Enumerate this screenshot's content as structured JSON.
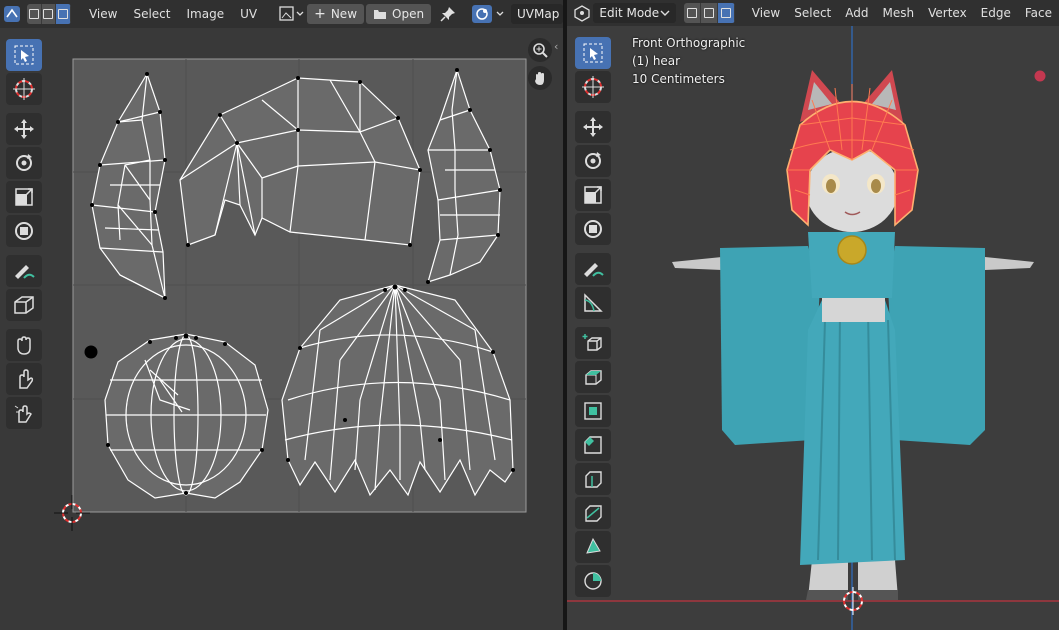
{
  "uv_editor": {
    "menus": [
      "View",
      "Select",
      "Image",
      "UV"
    ],
    "new_label": "New",
    "open_label": "Open",
    "uvmap_label": "UVMap"
  },
  "viewport": {
    "mode_label": "Edit Mode",
    "menus": [
      "View",
      "Select",
      "Add",
      "Mesh",
      "Vertex",
      "Edge",
      "Face"
    ],
    "overlay": {
      "view_name": "Front Orthographic",
      "object_name": "(1) hear",
      "scale_label": "10 Centimeters"
    }
  },
  "colors": {
    "accent": "#4772b3",
    "mesh_edge": "#ffffff",
    "hair": "#e8404a",
    "kimono": "#3fa7b8",
    "x_axis": "#c0343f",
    "z_axis": "#2e6fc2"
  },
  "icons": {
    "editor_type": "uv-editor-icon",
    "select_tool": "select-box-icon",
    "cursor_tool": "cursor-icon",
    "move_tool": "move-icon",
    "rotate_tool": "rotate-icon",
    "scale_tool": "scale-icon",
    "transform_tool": "transform-icon",
    "annotate_tool": "annotate-icon",
    "pin": "pin-icon"
  }
}
